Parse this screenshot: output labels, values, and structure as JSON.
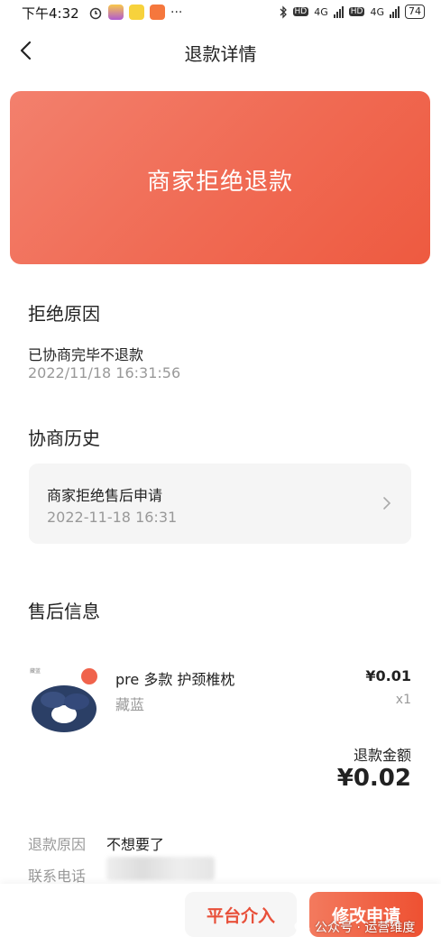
{
  "status_bar": {
    "time": "下午4:32",
    "battery": "74",
    "network_1": "4G",
    "network_2": "4G"
  },
  "nav": {
    "title": "退款详情"
  },
  "banner": {
    "status_text": "商家拒绝退款"
  },
  "reject_reason": {
    "title": "拒绝原因",
    "reason": "已协商完毕不退款",
    "time": "2022/11/18 16:31:56"
  },
  "history": {
    "title": "协商历史",
    "item_title": "商家拒绝售后申请",
    "item_time": "2022-11-18 16:31"
  },
  "aftersale": {
    "title": "售后信息",
    "product_name": "pre 多款 护颈椎枕",
    "product_spec": "藏蓝",
    "product_price": "¥0.01",
    "product_qty": "x1",
    "refund_label": "退款金额",
    "refund_amount": "¥0.02"
  },
  "info": {
    "reason_label": "退款原因",
    "reason_value": "不想要了",
    "phone_label": "联系电话"
  },
  "buttons": {
    "platform": "平台介入",
    "modify": "修改申请"
  },
  "watermark": "公众号 · 运营维度",
  "colors": {
    "accent": "#ee5a40",
    "banner_start": "#f3806d",
    "muted_text": "#999999"
  },
  "icons": [
    "back-arrow-icon",
    "chevron-right-icon",
    "wechat-icon",
    "bluetooth-icon",
    "alarm-icon"
  ]
}
